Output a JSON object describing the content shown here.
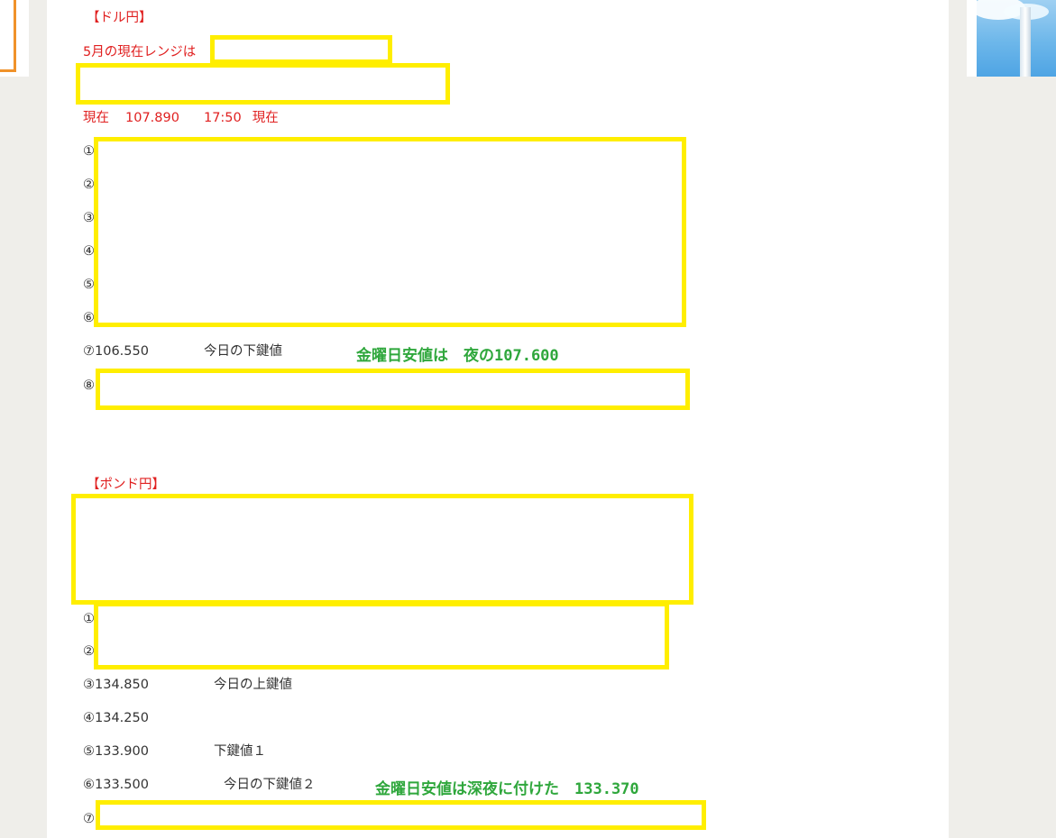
{
  "dollar_yen": {
    "heading": "【ドル円】",
    "range_label": "5月の現在レンジは",
    "current_label": "現在",
    "current_price": "107.890",
    "current_time": "17:50",
    "current_suffix": "現在",
    "circle_1": "①",
    "circle_2": "②",
    "circle_3": "③",
    "circle_4": "④",
    "circle_5": "⑤",
    "circle_6": "⑥",
    "level_7_price": "⑦106.550",
    "level_7_note": "今日の下鍵値",
    "circle_8": "⑧",
    "friday_low_note": "金曜日安値は　夜の107.600"
  },
  "pound_yen": {
    "heading": "【ポンド円】",
    "circle_1": "①",
    "circle_2": "②",
    "level_3_price": "③134.850",
    "level_3_note": "今日の上鍵値",
    "level_4_price": "④134.250",
    "level_5_price": "⑤133.900",
    "level_5_note": "下鍵値１",
    "level_6_price": "⑥133.500",
    "level_6_note": "今日の下鍵値２",
    "circle_7": "⑦",
    "friday_low_note": "金曜日安値は深夜に付けた　133.370"
  },
  "colors": {
    "redaction_border": "#ffee00",
    "heading_red": "#e02020",
    "annotation_green": "#2fa73c",
    "accent_orange": "#f0922a"
  }
}
